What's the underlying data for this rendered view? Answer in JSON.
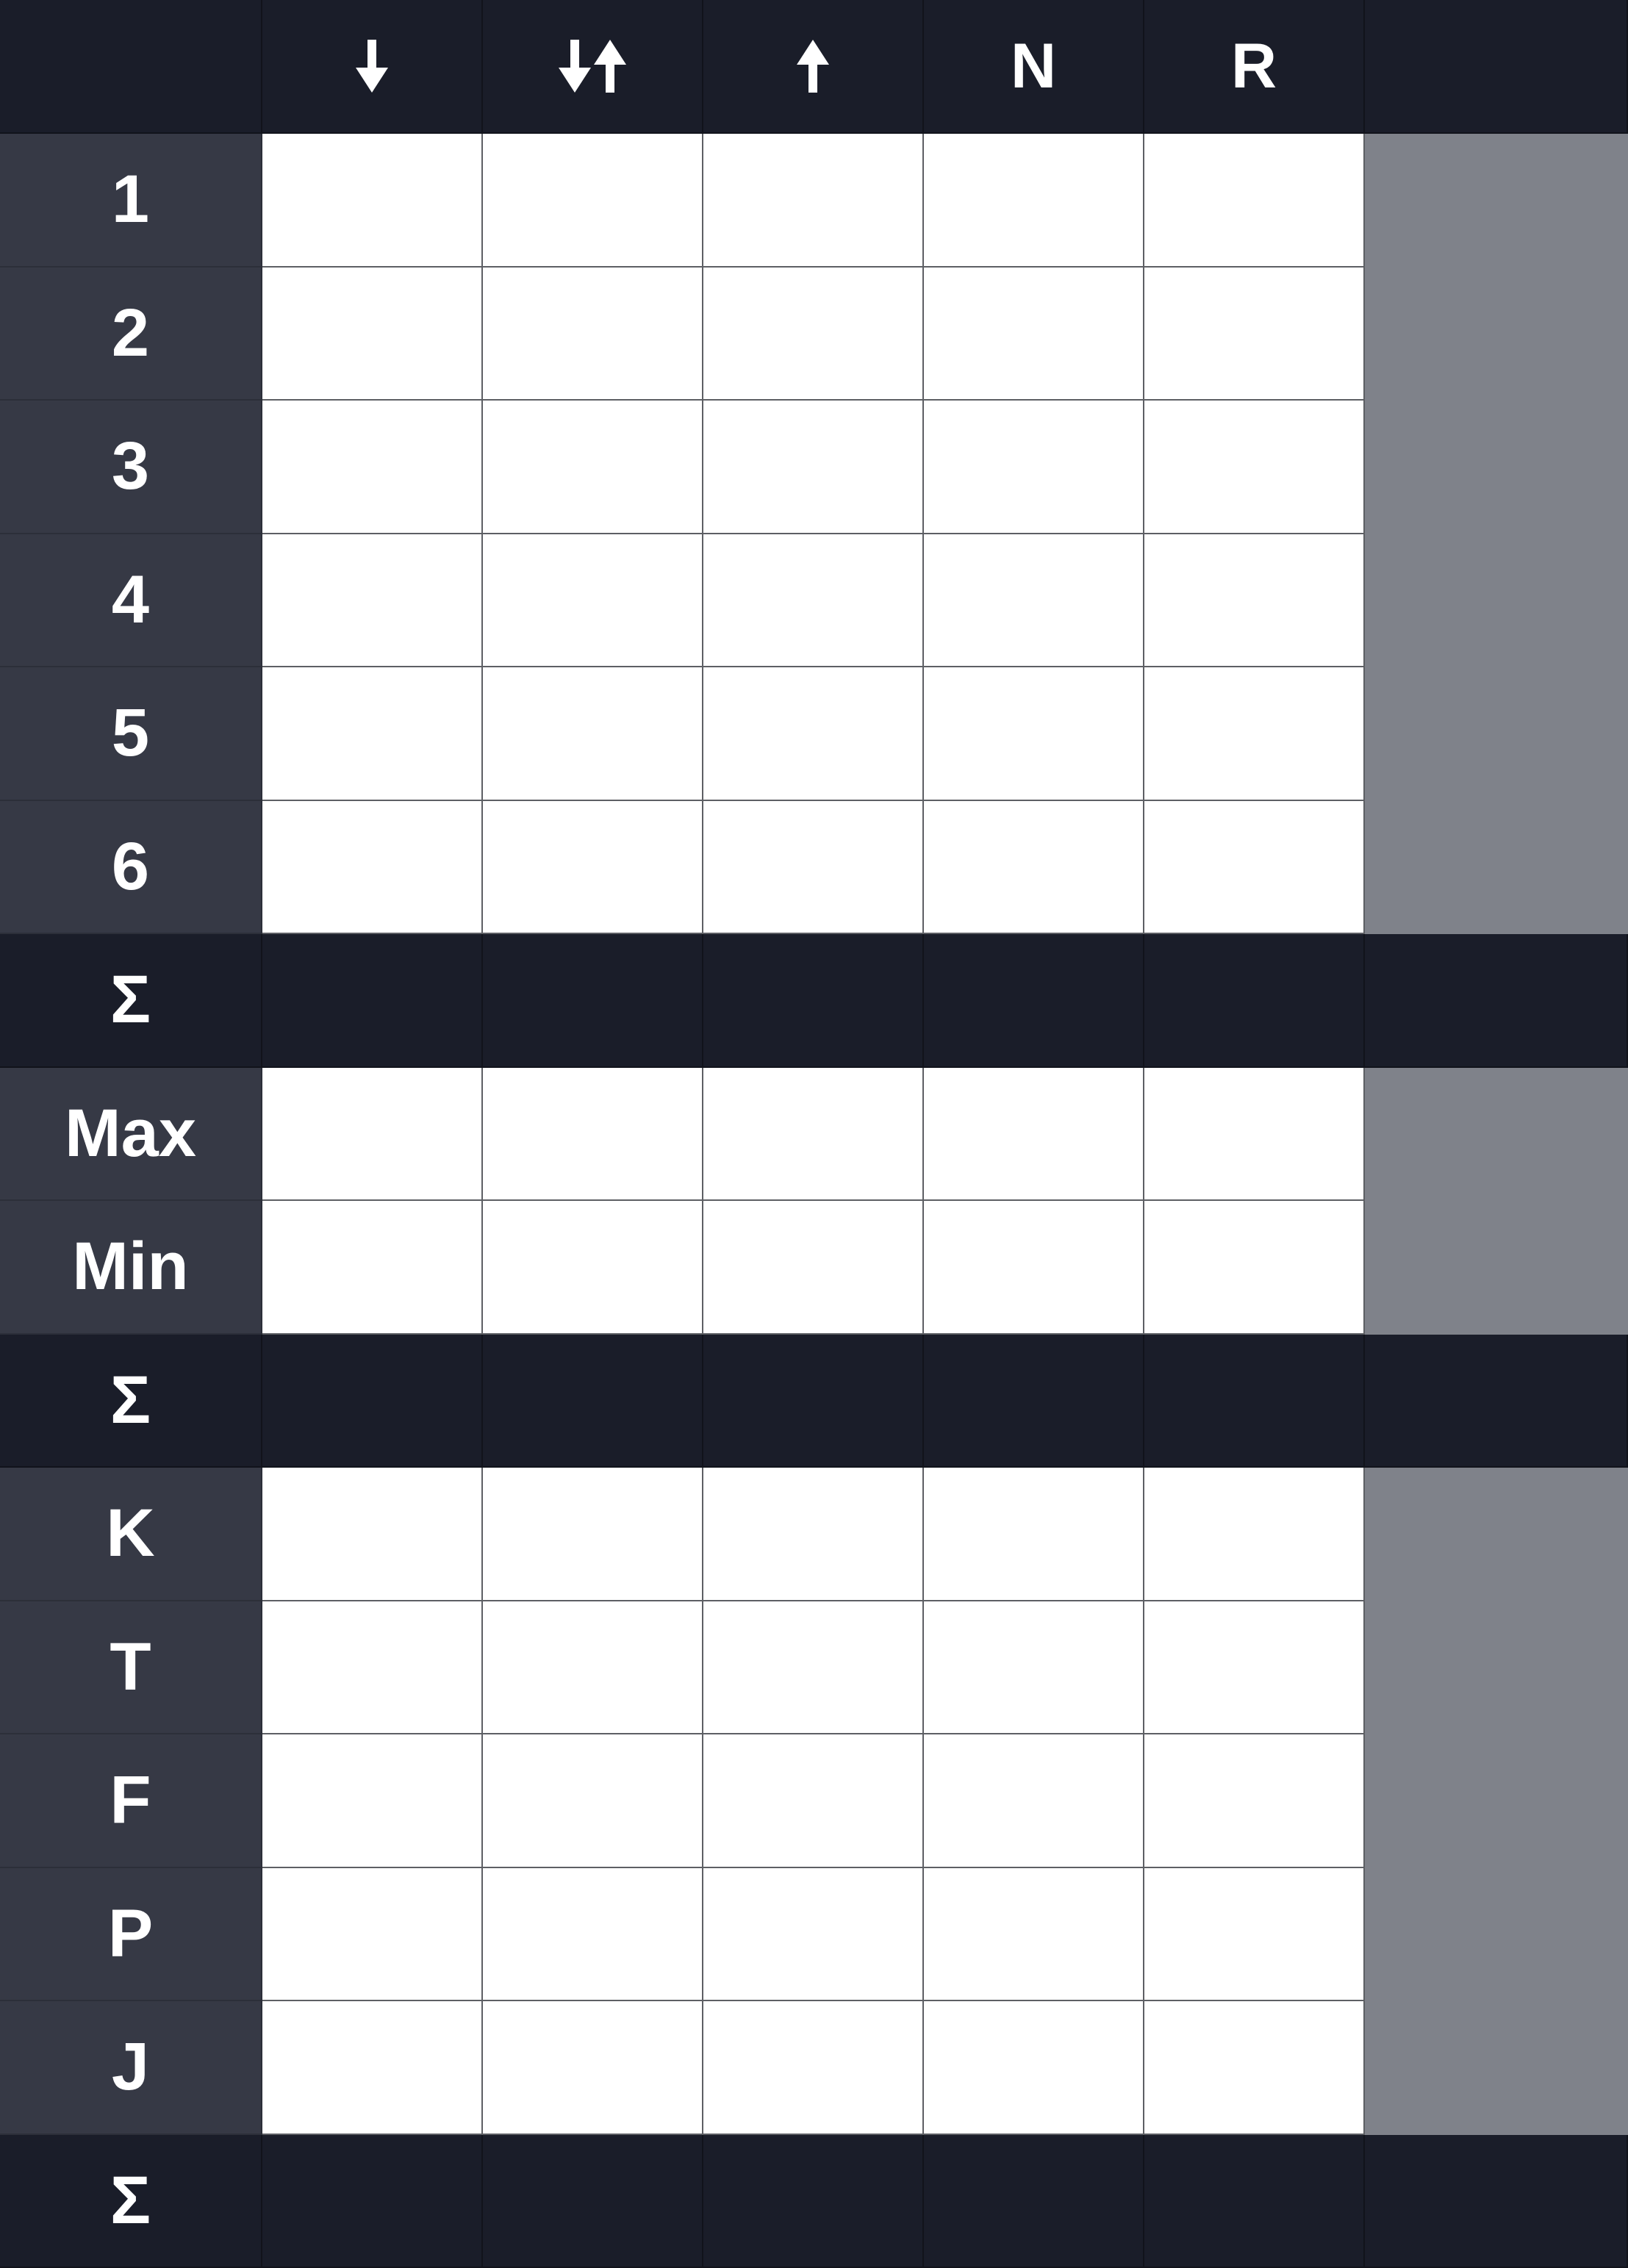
{
  "header": {
    "corner": "",
    "columns": [
      {
        "icon": "arrow-down-icon",
        "label": ""
      },
      {
        "icon": "arrow-down-up-icon",
        "label": ""
      },
      {
        "icon": "arrow-up-icon",
        "label": ""
      },
      {
        "icon": "",
        "label": "N"
      },
      {
        "icon": "",
        "label": "R"
      }
    ]
  },
  "sections": [
    {
      "rows": [
        "1",
        "2",
        "3",
        "4",
        "5",
        "6"
      ],
      "sum_label": "Σ"
    },
    {
      "rows": [
        "Max",
        "Min"
      ],
      "sum_label": "Σ"
    },
    {
      "rows": [
        "K",
        "T",
        "F",
        "P",
        "J"
      ],
      "sum_label": "Σ"
    }
  ],
  "colors": {
    "header_bg": "#1a1d29",
    "label_bg": "#363945",
    "side_column_bg": "#7f828a",
    "input_bg": "#ffffff",
    "text": "#ffffff"
  }
}
